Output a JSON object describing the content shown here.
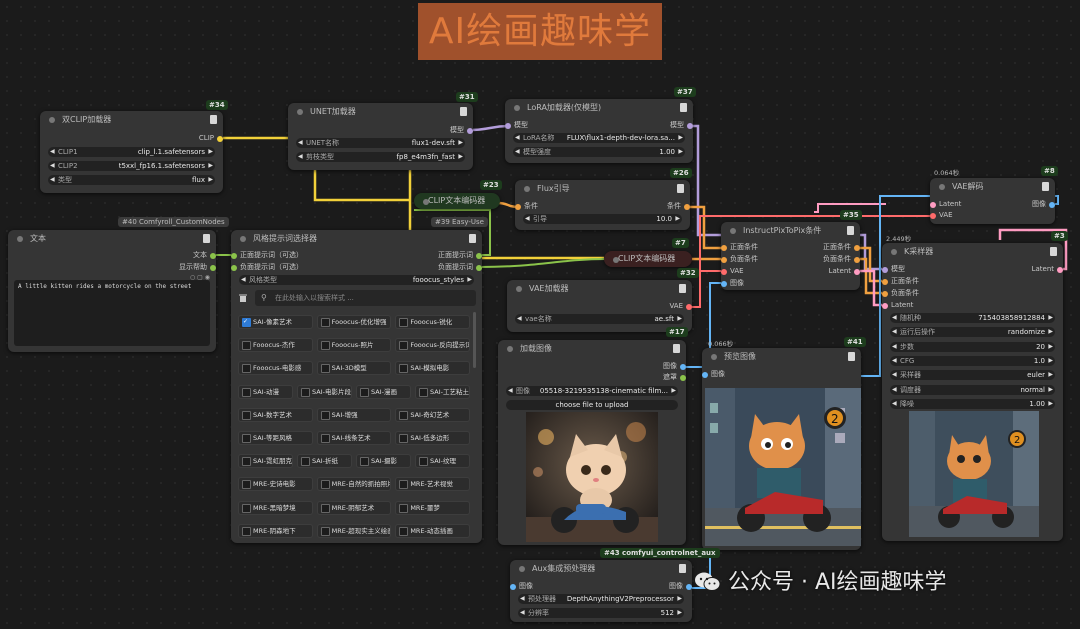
{
  "banner": {
    "title": "AI绘画趣味学"
  },
  "watermark": {
    "text": "公众号 · AI绘画趣味学",
    "icon": "wechat-icon"
  },
  "colors": {
    "clip": "#f2d13a",
    "model": "#b39ddb",
    "conditioning": "#f0a040",
    "latent": "#ff9cc2",
    "vae": "#ff6b6b",
    "image": "#64b5f6",
    "string": "#8bc34a"
  },
  "nodes": {
    "dualclip": {
      "id": "#34",
      "title": "双CLIP加载器",
      "output": "CLIP",
      "widgets": [
        {
          "k": "CLIP1",
          "v": "clip_l.1.safetensors"
        },
        {
          "k": "CLIP2",
          "v": "t5xxl_fp16.1.safetensors"
        },
        {
          "k": "类型",
          "v": "flux"
        }
      ]
    },
    "unet": {
      "id": "#31",
      "title": "UNET加载器",
      "output": "模型",
      "widgets": [
        {
          "k": "UNET名称",
          "v": "flux1-dev.sft"
        },
        {
          "k": "剪枝类型",
          "v": "fp8_e4m3fn_fast"
        }
      ]
    },
    "lora": {
      "id": "#37",
      "title": "LoRA加载器(仅模型)",
      "input": "模型",
      "output": "模型",
      "widgets": [
        {
          "k": "LoRA名称",
          "v": "FLUX\\flux1-depth-dev-lora.sa..."
        },
        {
          "k": "模型强度",
          "v": "1.00"
        }
      ]
    },
    "clipenc23": {
      "id": "#23",
      "title": "CLIP文本编码器"
    },
    "flux": {
      "id": "#26",
      "title": "Flux引导",
      "input": "条件",
      "output": "条件",
      "widgets": [
        {
          "k": "引导",
          "v": "10.0"
        }
      ]
    },
    "text": {
      "id": "#40 Comfyroll_CustomNodes",
      "title": "文本",
      "outputs": [
        "文本",
        "显示帮助"
      ],
      "content": "A little kitten rides a motorcycle on the street"
    },
    "style": {
      "id": "#39 Easy-Use",
      "title": "风格提示词选择器",
      "inputs": [
        "正面提示词（可选）",
        "负面提示词（可选）"
      ],
      "outputs": [
        "正面提示词",
        "负面提示词"
      ],
      "style_type": {
        "k": "风格类型",
        "v": "fooocus_styles"
      },
      "search_placeholder": "在此处输入以搜索样式 ...",
      "styles": [
        [
          "SAI-像素艺术",
          "Fooocus-优化增强",
          "Fooocus-锐化"
        ],
        [
          "Fooocus-杰作",
          "Fooocus-照片",
          "Fooocus-反向提示词"
        ],
        [
          "Fooocus-电影感",
          "SAI-3D模型",
          "SAI-模拟电影"
        ],
        [
          "SAI-动漫",
          "SAI-电影片段",
          "SAI-漫画",
          "SAI-工艺粘土"
        ],
        [
          "SAI-数字艺术",
          "SAI-增强",
          "SAI-奇幻艺术"
        ],
        [
          "SAI-等距风格",
          "SAI-线条艺术",
          "SAI-低多边形"
        ],
        [
          "SAI-霓虹朋克",
          "SAI-折纸",
          "SAI-摄影",
          "SAI-纹理"
        ],
        [
          "MRE-史诗电影",
          "MRE-自然的抓拍照片",
          "MRE-艺术视觉"
        ],
        [
          "MRE-黑暗梦境",
          "MRE-阴郁艺术",
          "MRE-噩梦"
        ],
        [
          "MRE-阴森地下",
          "MRE-超现实主义绘画",
          "MRE-动态插画"
        ]
      ]
    },
    "clipenc7": {
      "id": "#7",
      "title": "CLIP文本编码器"
    },
    "vaeloader": {
      "id": "#32",
      "title": "VAE加载器",
      "output": "VAE",
      "widgets": [
        {
          "k": "vae名称",
          "v": "ae.sft"
        }
      ]
    },
    "loadimage": {
      "id": "#17",
      "title": "加载图像",
      "outputs": [
        "图像",
        "遮罩"
      ],
      "widgets": [
        {
          "k": "图像",
          "v": "05518-3219535138-cinematic film..."
        }
      ],
      "upload_label": "choose file to upload"
    },
    "instruct": {
      "id": "#35",
      "title": "InstructPixToPix条件",
      "inputs": [
        "正面条件",
        "负面条件",
        "VAE",
        "图像"
      ],
      "outputs": [
        "正面条件",
        "负面条件",
        "Latent"
      ]
    },
    "vaedecode": {
      "id": "#8",
      "time": "0.064秒",
      "title": "VAE解码",
      "inputs": [
        "Latent",
        "VAE"
      ],
      "output": "图像"
    },
    "preview": {
      "id": "#41",
      "time": "0.066秒",
      "title": "预览图像",
      "input": "图像"
    },
    "ksampler": {
      "id": "#3",
      "time": "2.449秒",
      "title": "K采样器",
      "inputs": [
        "模型",
        "正面条件",
        "负面条件",
        "Latent"
      ],
      "output": "Latent",
      "widgets": [
        {
          "k": "随机种",
          "v": "715403858912884"
        },
        {
          "k": "运行后操作",
          "v": "randomize"
        },
        {
          "k": "步数",
          "v": "20"
        },
        {
          "k": "CFG",
          "v": "1.0"
        },
        {
          "k": "采样器",
          "v": "euler"
        },
        {
          "k": "调度器",
          "v": "normal"
        },
        {
          "k": "降噪",
          "v": "1.00"
        }
      ]
    },
    "aux": {
      "id": "#43 comfyui_controlnet_aux",
      "title": "Aux集成预处理器",
      "input": "图像",
      "output": "图像",
      "widgets": [
        {
          "k": "预处理器",
          "v": "DepthAnythingV2Preprocessor"
        },
        {
          "k": "分辨率",
          "v": "512"
        }
      ]
    }
  }
}
